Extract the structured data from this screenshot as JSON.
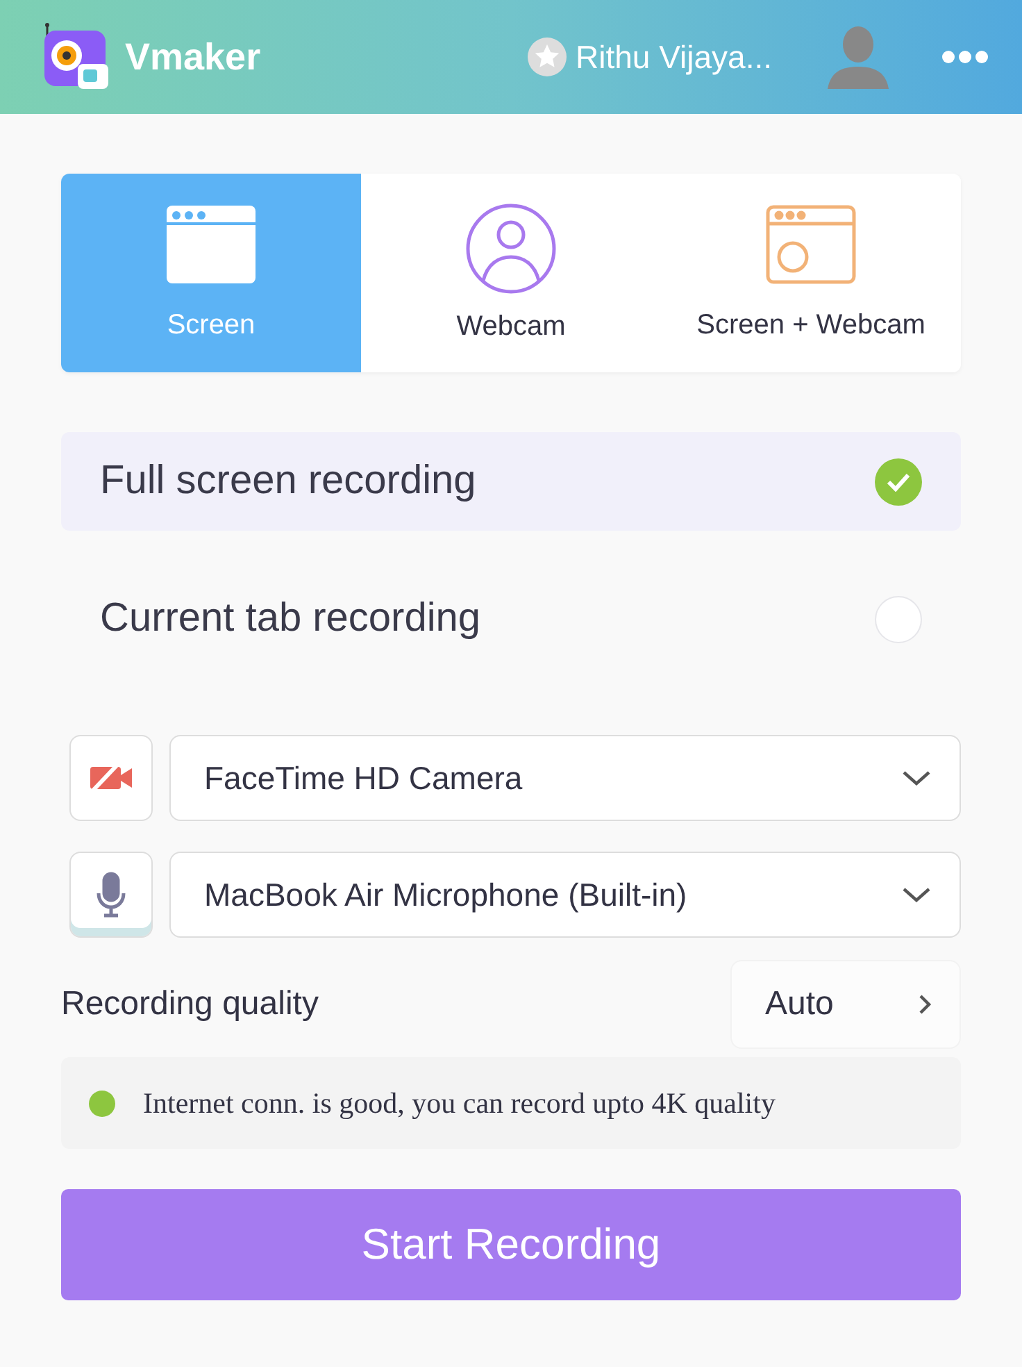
{
  "header": {
    "app_name": "Vmaker",
    "user_name": "Rithu Vijaya..."
  },
  "modes": [
    {
      "kind": "screen",
      "label": "Screen",
      "selected": true
    },
    {
      "kind": "webcam",
      "label": "Webcam",
      "selected": false
    },
    {
      "kind": "both",
      "label": "Screen + Webcam",
      "selected": false
    }
  ],
  "options": [
    {
      "label": "Full screen recording",
      "selected": true
    },
    {
      "label": "Current tab recording",
      "selected": false
    }
  ],
  "devices": [
    {
      "kind": "camera",
      "value": "FaceTime HD Camera",
      "on": false
    },
    {
      "kind": "microphone",
      "value": "MacBook Air Microphone (Built-in)",
      "on": true
    }
  ],
  "quality": {
    "label": "Recording quality",
    "value": "Auto"
  },
  "status": {
    "text": "Internet conn. is good, you can record upto 4K quality",
    "color": "#8dc63f"
  },
  "start_button": "Start Recording"
}
